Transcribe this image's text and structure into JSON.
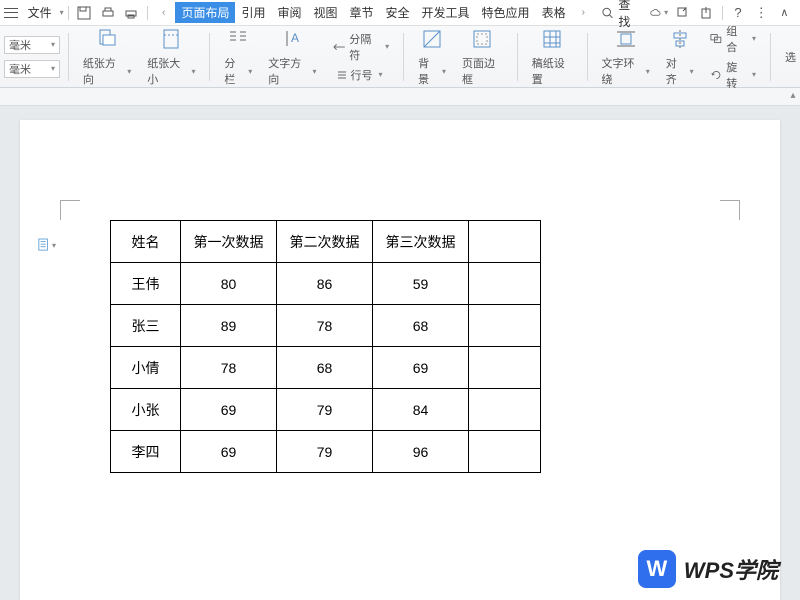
{
  "menubar": {
    "file": "文件",
    "tabs": [
      "页面布局",
      "引用",
      "审阅",
      "视图",
      "章节",
      "安全",
      "开发工具",
      "特色应用",
      "表格"
    ],
    "active_tab_index": 0,
    "search": "查找"
  },
  "ribbon": {
    "unit": "毫米",
    "page_orientation": "纸张方向",
    "page_size": "纸张大小",
    "columns": "分栏",
    "text_direction": "文字方向",
    "separator": "分隔符",
    "line_number": "行号",
    "background": "背景",
    "page_border": "页面边框",
    "gaozhishe": "稿纸设置",
    "text_wrap": "文字环绕",
    "align": "对齐",
    "group": "组合",
    "rotate": "旋转",
    "select": "选"
  },
  "table": {
    "headers": [
      "姓名",
      "第一次数据",
      "第二次数据",
      "第三次数据",
      ""
    ],
    "rows": [
      [
        "王伟",
        "80",
        "86",
        "59",
        ""
      ],
      [
        "张三",
        "89",
        "78",
        "68",
        ""
      ],
      [
        "小倩",
        "78",
        "68",
        "69",
        ""
      ],
      [
        "小张",
        "69",
        "79",
        "84",
        ""
      ],
      [
        "李四",
        "69",
        "79",
        "96",
        ""
      ]
    ]
  },
  "watermark": {
    "logo": "W",
    "text": "WPS学院"
  }
}
